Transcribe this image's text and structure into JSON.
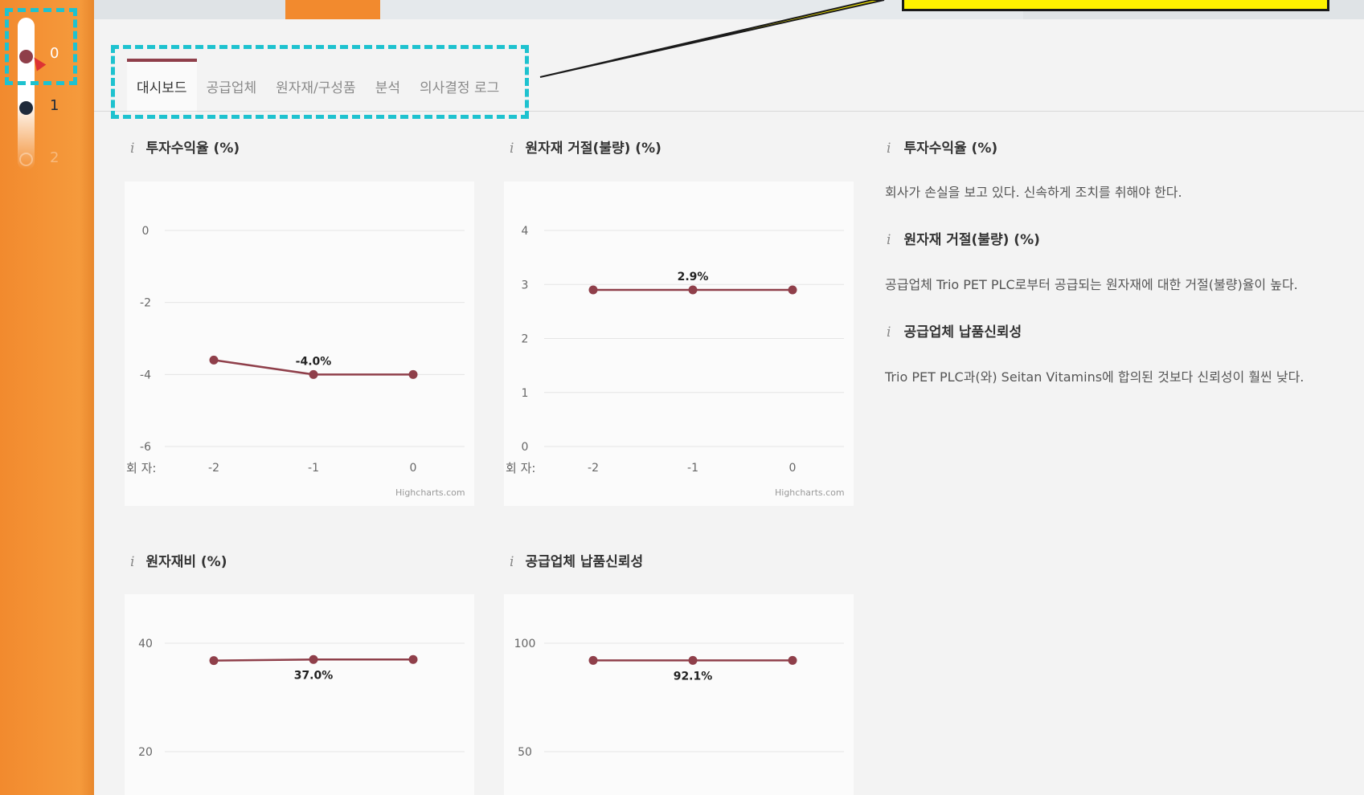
{
  "rounds": {
    "items": [
      "0",
      "1",
      "2"
    ]
  },
  "tabs": [
    {
      "label": "대시보드",
      "active": true
    },
    {
      "label": "공급업체",
      "active": false
    },
    {
      "label": "원자재/구성품",
      "active": false
    },
    {
      "label": "분석",
      "active": false
    },
    {
      "label": "의사결정 로그",
      "active": false
    }
  ],
  "colors": {
    "accent": "#8f3f4a",
    "sidebar": "#f28a2e",
    "highlight": "#1ec2cf",
    "callout": "#fff200"
  },
  "panels": {
    "roi": {
      "title": "투자수익율 (%)",
      "credit": "Highcharts.com",
      "xprefix": "회 자:"
    },
    "reject": {
      "title": "원자재 거절(불량) (%)",
      "credit": "Highcharts.com",
      "xprefix": "회 자:"
    },
    "material": {
      "title": "원자재비 (%)"
    },
    "delivery": {
      "title": "공급업체 납품신뢰성"
    }
  },
  "chart_data": [
    {
      "type": "line",
      "title": "투자수익율 (%)",
      "x": [
        -2,
        -1,
        0
      ],
      "values": [
        -3.6,
        -4.0,
        -4.0
      ],
      "data_label": "-4.0%",
      "ylim": [
        -6,
        0
      ],
      "yticks": [
        "0",
        "-2",
        "-4",
        "-6"
      ],
      "xticks": [
        "-2",
        "-1",
        "0"
      ]
    },
    {
      "type": "line",
      "title": "원자재 거절(불량) (%)",
      "x": [
        -2,
        -1,
        0
      ],
      "values": [
        2.9,
        2.9,
        2.9
      ],
      "data_label": "2.9%",
      "ylim": [
        0,
        4
      ],
      "yticks": [
        "4",
        "3",
        "2",
        "1",
        "0"
      ],
      "xticks": [
        "-2",
        "-1",
        "0"
      ]
    },
    {
      "type": "line",
      "title": "원자재비 (%)",
      "x": [
        -2,
        -1,
        0
      ],
      "values": [
        36.8,
        37.0,
        37.0
      ],
      "data_label": "37.0%",
      "yticks": [
        "40",
        "20"
      ]
    },
    {
      "type": "line",
      "title": "공급업체 납품신뢰성",
      "x": [
        -2,
        -1,
        0
      ],
      "values": [
        92.1,
        92.1,
        92.1
      ],
      "data_label": "92.1%",
      "yticks": [
        "100",
        "50"
      ]
    }
  ],
  "info": [
    {
      "title": "투자수익율 (%)",
      "text": "회사가 손실을 보고 있다. 신속하게 조치를 취해야 한다."
    },
    {
      "title": "원자재 거절(불량) (%)",
      "text": "공급업체 Trio PET PLC로부터 공급되는 원자재에 대한 거절(불량)율이 높다."
    },
    {
      "title": "공급업체 납품신뢰성",
      "text": "Trio PET PLC과(와) Seitan Vitamins에 합의된 것보다 신뢰성이 훨씬 낮다."
    }
  ]
}
